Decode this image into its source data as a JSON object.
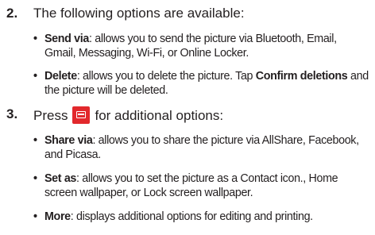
{
  "steps": [
    {
      "number": "2.",
      "text": "The following options are available:"
    },
    {
      "number": "3.",
      "text_before": "Press",
      "icon": "menu-key-icon",
      "text_after": "for additional options:"
    }
  ],
  "bullets_step2": [
    {
      "term": "Send via",
      "line1": ": allows you to send the picture via Bluetooth, Email,",
      "line2": "Gmail, Messaging, Wi-Fi, or Online Locker."
    },
    {
      "term": "Delete",
      "line1_before": ": allows you to delete the picture. Tap ",
      "line1_strong": "Confirm deletions",
      "line1_after": " and",
      "line2": "the picture will be deleted."
    }
  ],
  "bullets_step3": [
    {
      "term": "Share via",
      "line1": ": allows you to share the picture via AllShare, Facebook,",
      "line2": "and Picasa."
    },
    {
      "term": "Set as",
      "line1": ": allows you to set the picture as a Contact icon., Home",
      "line2": "screen wallpaper, or Lock screen wallpaper."
    },
    {
      "term": "More",
      "line1": ": displays additional options for editing and printing."
    }
  ],
  "bullet_glyph": "•",
  "colors": {
    "text": "#231f20",
    "menu_key": "#e2282c"
  }
}
